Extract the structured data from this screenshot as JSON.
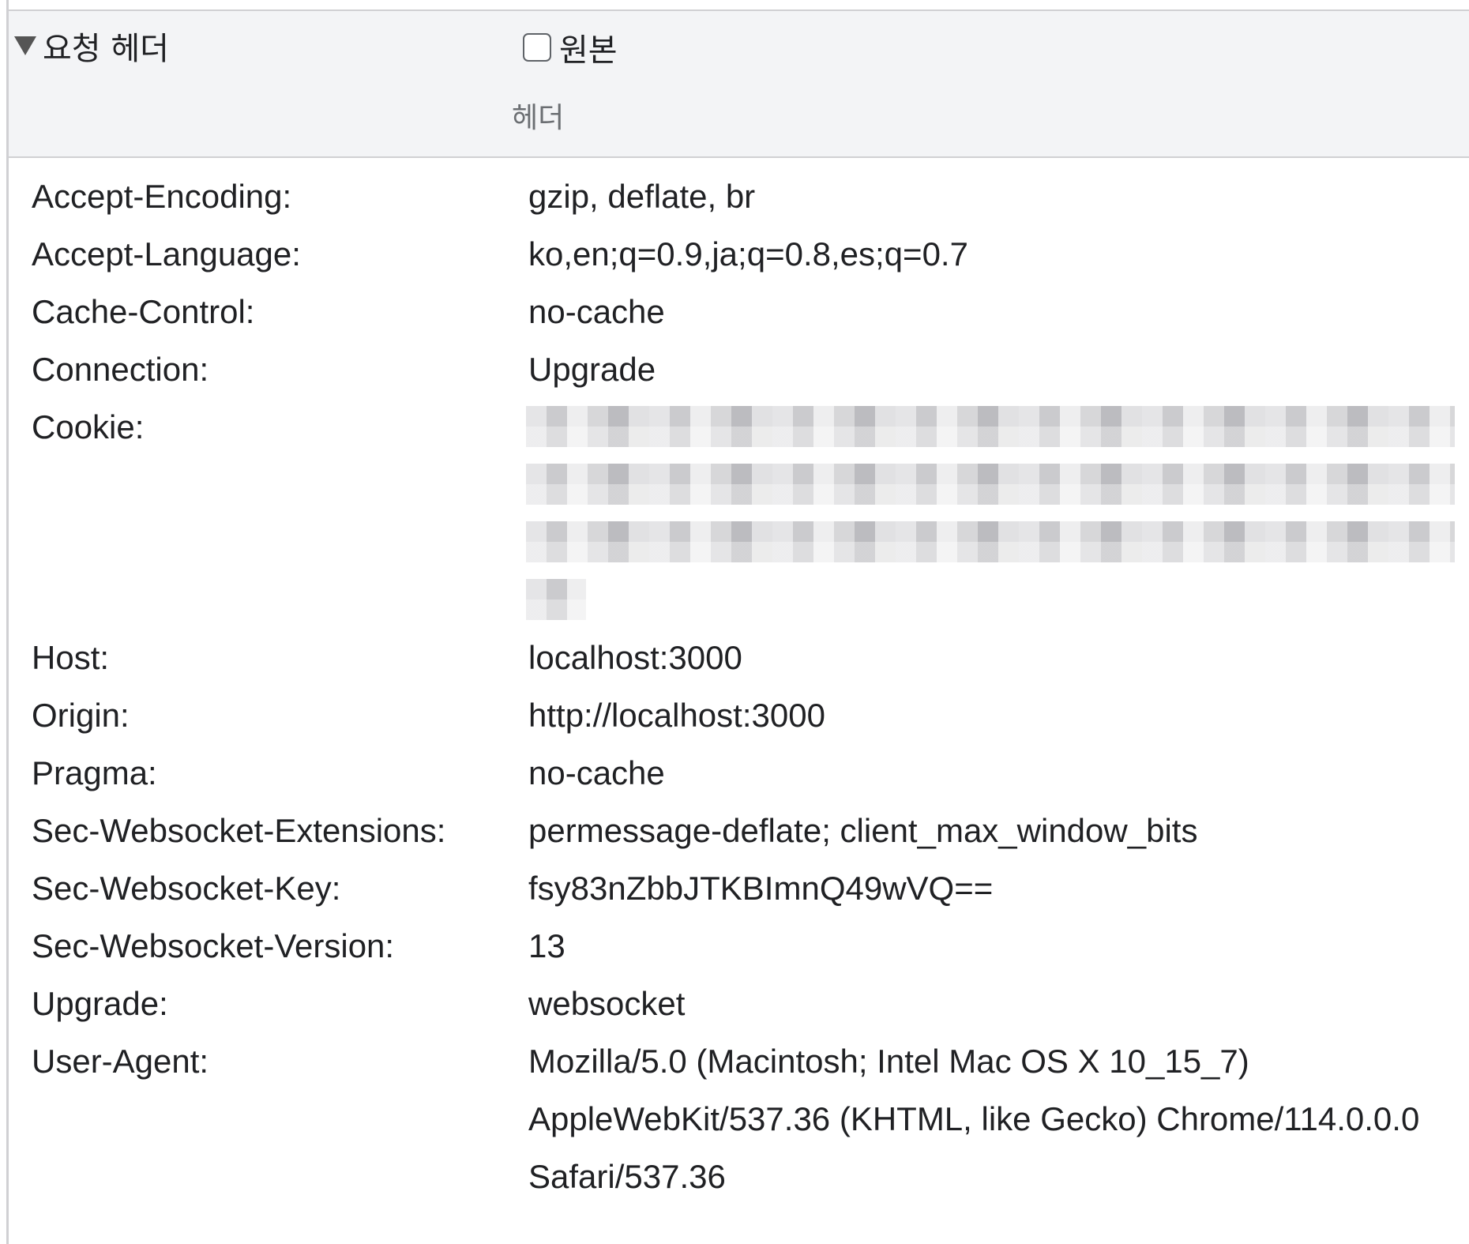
{
  "section": {
    "title": "요청 헤더",
    "raw_label": "원본",
    "raw_checked": false,
    "column_header": "헤더"
  },
  "headers": [
    {
      "name": "Accept-Encoding:",
      "value": [
        "gzip, deflate, br"
      ]
    },
    {
      "name": "Accept-Language:",
      "value": [
        "ko,en;q=0.9,ja;q=0.8,es;q=0.7"
      ]
    },
    {
      "name": "Cache-Control:",
      "value": [
        "no-cache"
      ]
    },
    {
      "name": "Connection:",
      "value": [
        "Upgrade"
      ]
    },
    {
      "name": "Cookie:",
      "value": [],
      "redacted": true
    },
    {
      "name": "Host:",
      "value": [
        "localhost:3000"
      ]
    },
    {
      "name": "Origin:",
      "value": [
        "http://localhost:3000"
      ]
    },
    {
      "name": "Pragma:",
      "value": [
        "no-cache"
      ]
    },
    {
      "name": "Sec-Websocket-Extensions:",
      "value": [
        "permessage-deflate; client_max_window_bits"
      ]
    },
    {
      "name": "Sec-Websocket-Key:",
      "value": [
        "fsy83nZbbJTKBImnQ49wVQ=="
      ]
    },
    {
      "name": "Sec-Websocket-Version:",
      "value": [
        "13"
      ]
    },
    {
      "name": "Upgrade:",
      "value": [
        "websocket"
      ]
    },
    {
      "name": "User-Agent:",
      "value": [
        "Mozilla/5.0 (Macintosh; Intel Mac OS X 10_15_7)",
        "AppleWebKit/537.36 (KHTML, like Gecko) Chrome/114.0.0.0",
        "Safari/537.36"
      ]
    }
  ],
  "colors": {
    "header_background": "#f3f4f6",
    "border": "#d0d0d3",
    "text": "#202124",
    "muted_text": "#6b6e72"
  }
}
